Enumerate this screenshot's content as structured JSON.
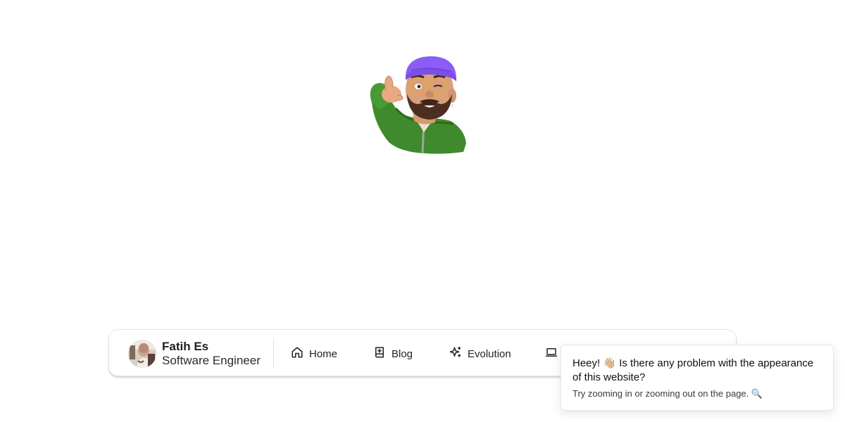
{
  "profile": {
    "name": "Fatih Es",
    "role": "Software Engineer",
    "avatar_icon": "profile-photo"
  },
  "nav": {
    "home": {
      "label": "Home",
      "icon": "home-icon"
    },
    "blog": {
      "label": "Blog",
      "icon": "book-icon"
    },
    "evolution": {
      "label": "Evolution",
      "icon": "sparkles-icon"
    },
    "more": {
      "label": "",
      "icon": "laptop-icon"
    }
  },
  "toast": {
    "title": "Heey! 👋🏼 Is there any problem with the appearance of this website?",
    "description": "Try zooming in or zooming out on the page. 🔍"
  },
  "colors": {
    "beanie": "#8b5cf6",
    "jacket": "#3f8a2c",
    "text": "#222222"
  }
}
